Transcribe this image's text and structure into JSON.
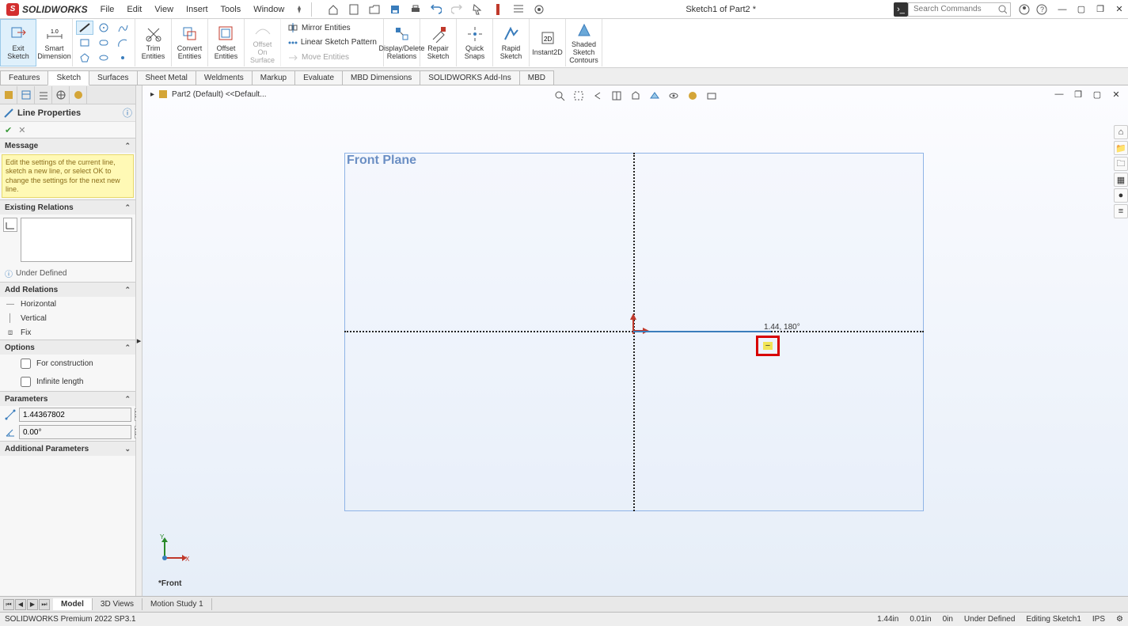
{
  "title": {
    "app": "SOLIDWORKS",
    "doc": "Sketch1 of Part2 *"
  },
  "menu": [
    "File",
    "Edit",
    "View",
    "Insert",
    "Tools",
    "Window"
  ],
  "search": {
    "placeholder": "Search Commands"
  },
  "ribbon": {
    "exit_sketch": "Exit\nSketch",
    "smart_dim": "Smart\nDimension",
    "trim": "Trim\nEntities",
    "convert": "Convert\nEntities",
    "offset": "Offset\nEntities",
    "offset_surface": "Offset\nOn\nSurface",
    "mirror": "Mirror Entities",
    "linear_pattern": "Linear Sketch Pattern",
    "move": "Move Entities",
    "display_relations": "Display/Delete\nRelations",
    "repair": "Repair\nSketch",
    "quick_snaps": "Quick\nSnaps",
    "rapid": "Rapid\nSketch",
    "instant2d": "Instant2D",
    "shaded": "Shaded\nSketch\nContours"
  },
  "tabs": [
    "Features",
    "Sketch",
    "Surfaces",
    "Sheet Metal",
    "Weldments",
    "Markup",
    "Evaluate",
    "MBD Dimensions",
    "SOLIDWORKS Add-Ins",
    "MBD"
  ],
  "active_tab": "Sketch",
  "breadcrumb": "Part2 (Default) <<Default...",
  "panel": {
    "title": "Line Properties",
    "sections": {
      "message": "Message",
      "message_text": "Edit the settings of the current line, sketch a new line, or select OK to change the settings for the next new line.",
      "existing": "Existing Relations",
      "status": "Under Defined",
      "add": "Add Relations",
      "add_items": {
        "horizontal": "Horizontal",
        "vertical": "Vertical",
        "fix": "Fix"
      },
      "options": "Options",
      "opt_items": {
        "construction": "For construction",
        "infinite": "Infinite length"
      },
      "parameters": "Parameters",
      "param_length": "1.44367802",
      "param_angle": "0.00°",
      "additional": "Additional Parameters"
    }
  },
  "canvas": {
    "plane_label": "Front Plane",
    "draw_label": "1.44, 180°",
    "view_name": "*Front",
    "relation_glyph": "−"
  },
  "bottom_tabs": [
    "Model",
    "3D Views",
    "Motion Study 1"
  ],
  "active_bottom_tab": "Model",
  "status": {
    "product": "SOLIDWORKS Premium 2022 SP3.1",
    "x": "1.44in",
    "y": "0.01in",
    "z": "0in",
    "defined": "Under Defined",
    "editing": "Editing Sketch1",
    "units": "IPS"
  }
}
